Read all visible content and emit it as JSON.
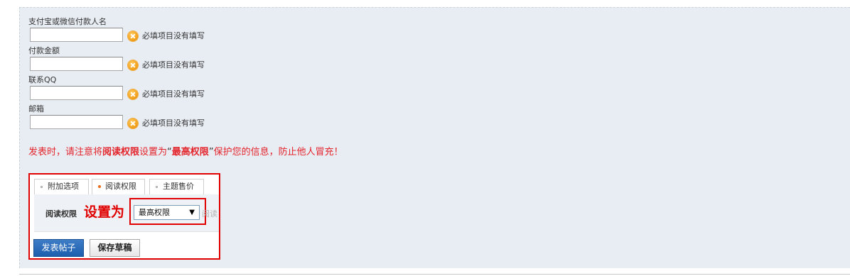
{
  "form": {
    "fields": [
      {
        "label": "支付宝或微信付款人名",
        "value": "",
        "error": "必填项目没有填写"
      },
      {
        "label": "付款金额",
        "value": "",
        "error": "必填项目没有填写"
      },
      {
        "label": "联系QQ",
        "value": "",
        "error": "必填项目没有填写"
      },
      {
        "label": "邮箱",
        "value": "",
        "error": "必填项目没有填写"
      }
    ],
    "notice": {
      "part1": "发表时，请注意将",
      "bold1": "阅读权限",
      "part2": "设置为",
      "quote_open": "“",
      "bold2": "最高权限",
      "quote_close": "”",
      "part3": "保护您的信息，防止他人冒充！"
    }
  },
  "options": {
    "tabs": [
      {
        "label": "附加选项"
      },
      {
        "label": "阅读权限"
      },
      {
        "label": "主题售价"
      }
    ],
    "read_permission_label": "阅读权限",
    "annotation": "设置为",
    "select_value": "最高权限",
    "select_caret": "▼",
    "hint": "阅读"
  },
  "buttons": {
    "post": "发表帖子",
    "save_draft": "保存草稿"
  },
  "colors": {
    "accent_blue": "#1d5fae",
    "warning_red": "#e4242b",
    "error_icon": "#f3a21d"
  }
}
